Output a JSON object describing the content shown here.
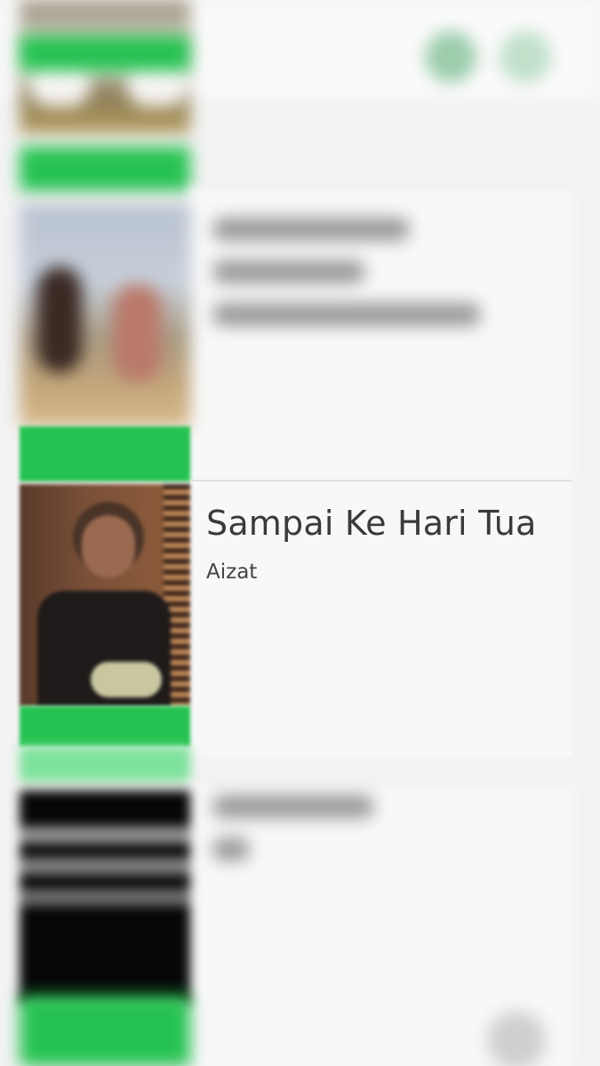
{
  "featured_song": {
    "title": "Sampai Ke Hari Tua",
    "artist": "Aizat"
  },
  "colors": {
    "accent_green": "#25c251",
    "background": "#f3f3f3",
    "title_text": "#3a3a3a"
  },
  "icons": {
    "top_right_1": "circle-icon",
    "top_right_2": "circle-icon",
    "bottom_right": "circle-icon"
  }
}
